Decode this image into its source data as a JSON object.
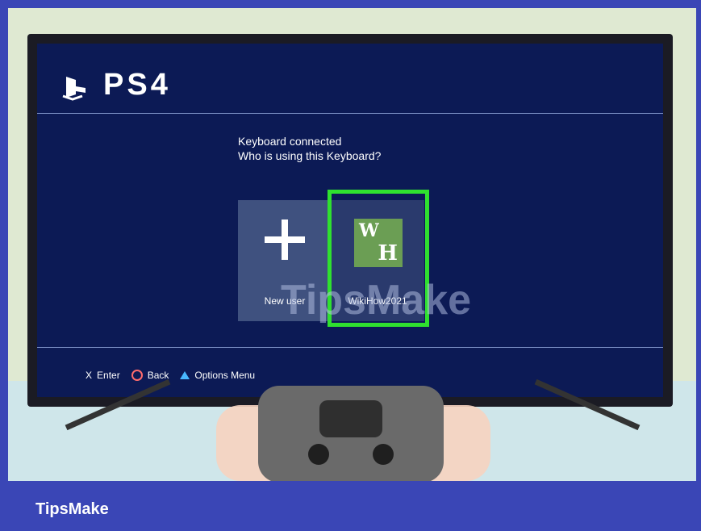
{
  "screen": {
    "logo": "PS4",
    "prompt_lines": [
      "Keyboard connected",
      "Who is using this Keyboard?"
    ],
    "tiles": [
      {
        "label": "New user",
        "icon": "plus-icon"
      },
      {
        "label": "WikiHow2021",
        "icon": "wikihow-avatar",
        "avatar": {
          "top": "W",
          "bottom": "H"
        }
      }
    ],
    "footer": [
      {
        "key_icon": "cross-icon",
        "key_text": "X",
        "label": "Enter"
      },
      {
        "key_icon": "circle-icon",
        "label": "Back"
      },
      {
        "key_icon": "triangle-icon",
        "label": "Options Menu"
      }
    ]
  },
  "branding": {
    "name": "TipsMake",
    "watermark": "TipsMake"
  },
  "colors": {
    "frame": "#3a46b6",
    "screen": "#0c1a55",
    "selection": "#2fe02f",
    "accent_triangle": "#48b8ff",
    "accent_circle": "#ff6c6c"
  }
}
